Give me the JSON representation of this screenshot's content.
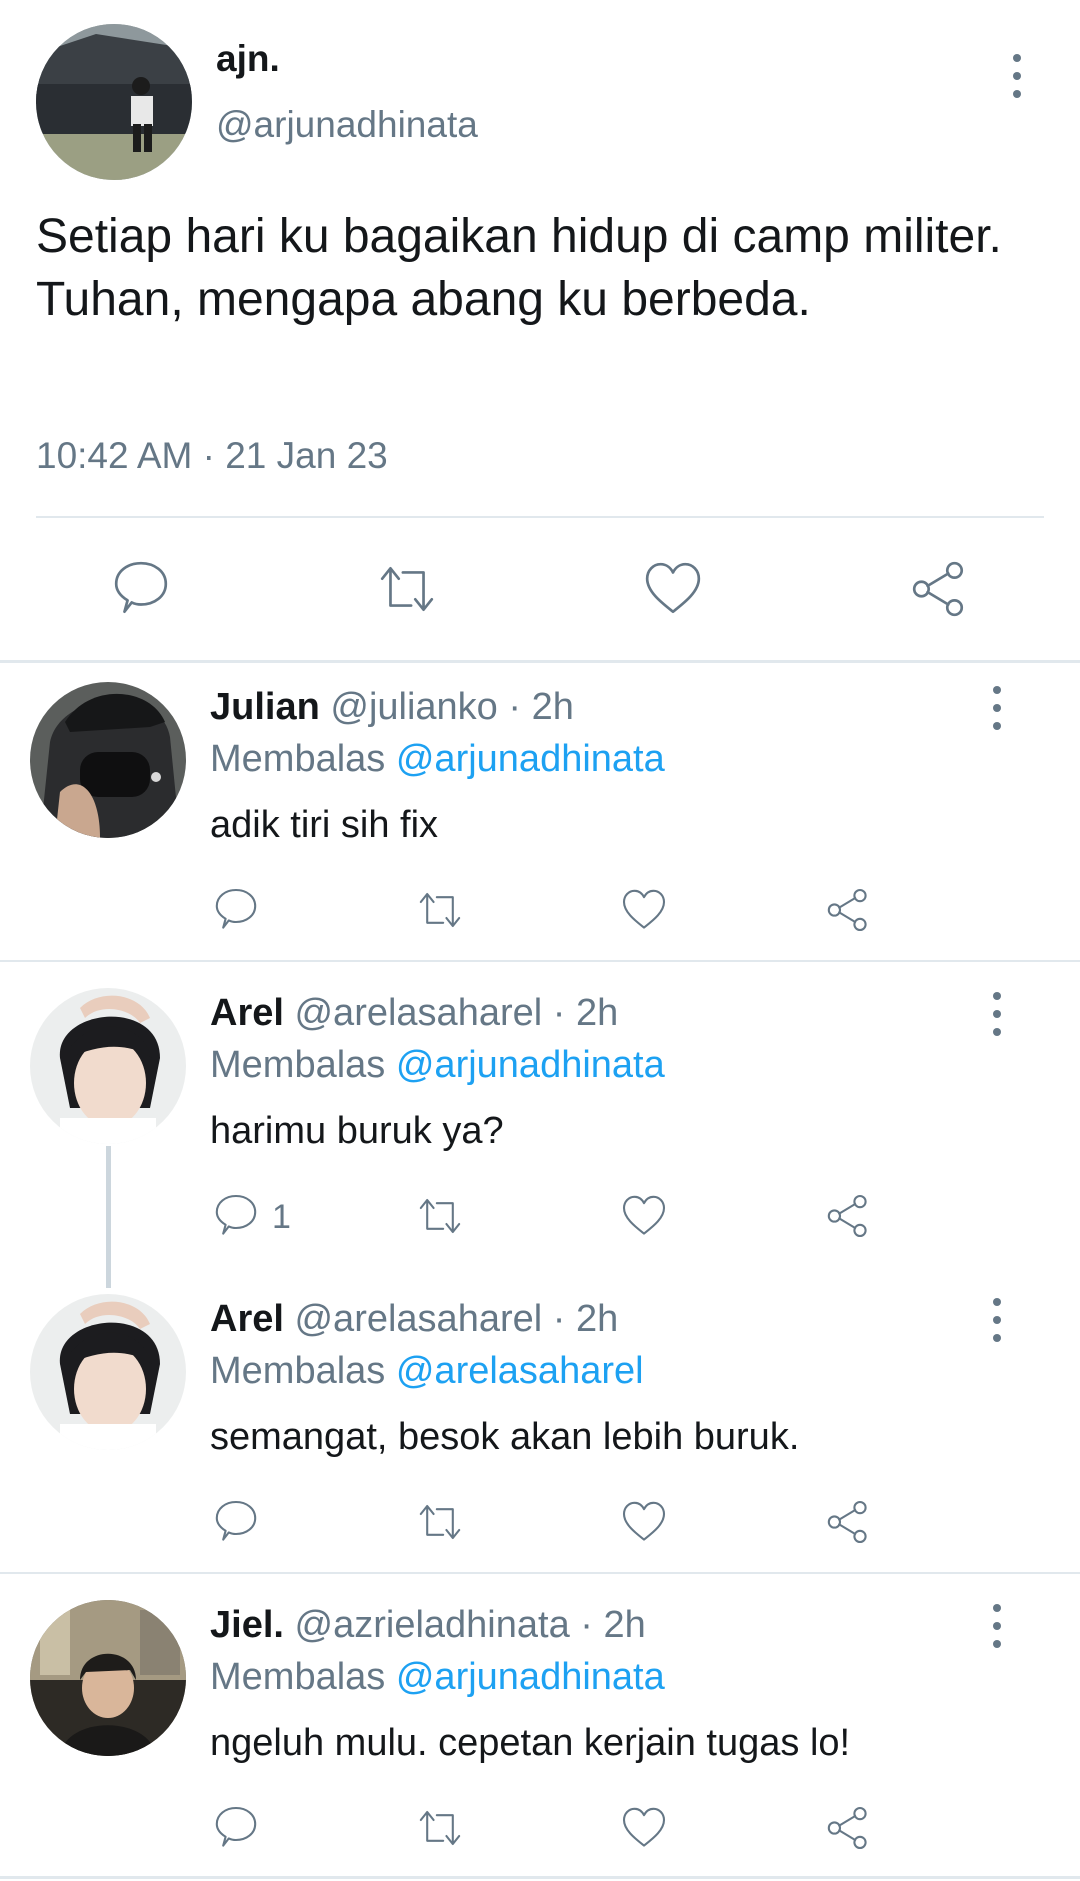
{
  "main_tweet": {
    "name": "ajn.",
    "handle": "@arjunadhinata",
    "text": "Setiap hari ku bagaikan hidup di camp militer. Tuhan, mengapa abang ku berbeda.",
    "timestamp": "10:42 AM · 21 Jan 23"
  },
  "reply_label": "Membalas",
  "replies": [
    {
      "name": "Julian",
      "handle": "@julianko",
      "time": "· 2h",
      "replying_to": "@arjunadhinata",
      "text": "adik tiri sih fix",
      "reply_count": ""
    },
    {
      "name": "Arel",
      "handle": "@arelasaharel",
      "time": "· 2h",
      "replying_to": "@arjunadhinata",
      "text": "harimu buruk ya?",
      "reply_count": "1"
    },
    {
      "name": "Arel",
      "handle": "@arelasaharel",
      "time": "· 2h",
      "replying_to": "@arelasaharel",
      "text": "semangat, besok akan lebih buruk.",
      "reply_count": ""
    },
    {
      "name": "Jiel.",
      "handle": "@azrieladhinata",
      "time": "· 2h",
      "replying_to": "@arjunadhinata",
      "text": "ngeluh mulu. cepetan kerjain tugas lo!",
      "reply_count": ""
    }
  ],
  "icons": {
    "reply": "speech-bubble-icon",
    "retweet": "retweet-icon",
    "like": "heart-icon",
    "share": "share-icon",
    "more": "kebab-menu-icon"
  },
  "colors": {
    "text": "#14171a",
    "secondary": "#657786",
    "mention": "#1da1f2",
    "divider": "#e1e8ed"
  }
}
